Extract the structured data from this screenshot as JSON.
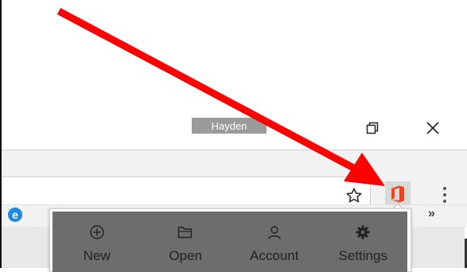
{
  "profile": {
    "name": "Hayden"
  },
  "window_controls": {
    "restore_icon": "restore-icon",
    "close_icon": "close-icon"
  },
  "toolbar": {
    "bookmark_icon": "star-icon",
    "extension_icon": "office-icon",
    "menu_icon": "kebab-menu-icon",
    "overflow_label": "»"
  },
  "bookmarks_bar": {
    "first_icon": "edge-icon",
    "overflow": "»"
  },
  "office_popup": {
    "actions": [
      {
        "label": "New",
        "icon": "plus-circle-icon"
      },
      {
        "label": "Open",
        "icon": "folder-open-icon"
      },
      {
        "label": "Account",
        "icon": "person-icon"
      },
      {
        "label": "Settings",
        "icon": "gear-icon"
      }
    ]
  },
  "annotation": {
    "arrow_color": "#ff0000",
    "extension_color": "#e8451e"
  }
}
